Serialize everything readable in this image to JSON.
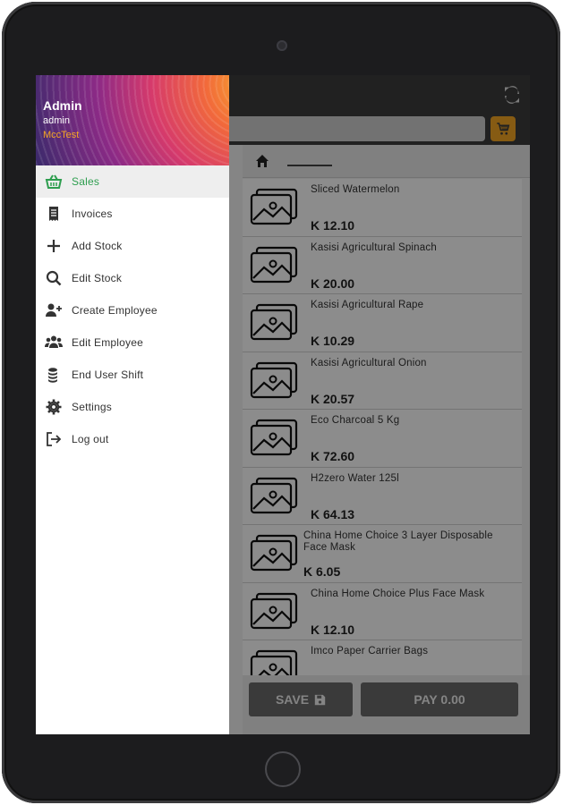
{
  "app": {
    "search": {
      "value": "",
      "placeholder": ""
    },
    "breadcrumb": {
      "home_label": "home"
    },
    "products": [
      {
        "name": "Sliced Watermelon",
        "price": "K 12.10"
      },
      {
        "name": "Kasisi Agricultural Spinach",
        "price": "K 20.00"
      },
      {
        "name": "Kasisi Agricultural Rape",
        "price": "K 10.29"
      },
      {
        "name": "Kasisi Agricultural Onion",
        "price": "K 20.57"
      },
      {
        "name": "Eco Charcoal 5 Kg",
        "price": "K 72.60"
      },
      {
        "name": "H2zero Water 125l",
        "price": "K 64.13"
      },
      {
        "name": "China Home Choice 3 Layer Disposable Face Mask",
        "price": "K 6.05"
      },
      {
        "name": "China Home Choice Plus Face Mask",
        "price": "K 12.10"
      },
      {
        "name": "Imco Paper Carrier Bags",
        "price": ""
      }
    ],
    "footer": {
      "save_label": "SAVE",
      "pay_label": "PAY 0.00"
    }
  },
  "drawer": {
    "header": {
      "name": "Admin",
      "username": "admin",
      "company": "MccTest"
    },
    "items": [
      {
        "label": "Sales",
        "icon": "basket-icon",
        "active": true
      },
      {
        "label": "Invoices",
        "icon": "receipt-icon",
        "active": false
      },
      {
        "label": "Add Stock",
        "icon": "plus-icon",
        "active": false
      },
      {
        "label": "Edit Stock",
        "icon": "search-icon",
        "active": false
      },
      {
        "label": "Create Employee",
        "icon": "user-plus-icon",
        "active": false
      },
      {
        "label": "Edit Employee",
        "icon": "users-icon",
        "active": false
      },
      {
        "label": "End User Shift",
        "icon": "coins-icon",
        "active": false
      },
      {
        "label": "Settings",
        "icon": "gear-icon",
        "active": false
      },
      {
        "label": "Log out",
        "icon": "logout-icon",
        "active": false
      }
    ]
  },
  "colors": {
    "accent": "#f5a623",
    "active": "#2e9e4f",
    "scrim": "#000000"
  }
}
